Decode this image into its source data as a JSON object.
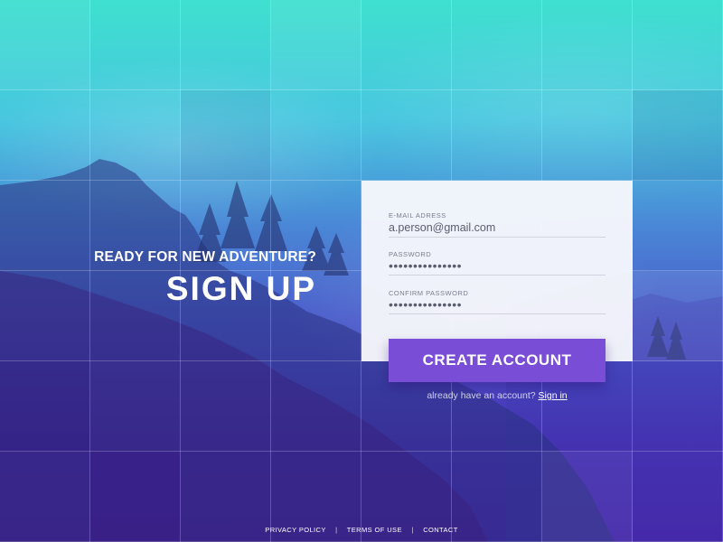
{
  "hero": {
    "tagline": "READY FOR NEW ADVENTURE?",
    "title": "SIGN UP"
  },
  "form": {
    "email_label": "E-MAIL ADRESS",
    "email_value": "a.person@gmail.com",
    "password_label": "PASSWORD",
    "password_value": "•••••••••••••••",
    "confirm_label": "CONFIRM PASSWORD",
    "confirm_value": "•••••••••••••••",
    "submit_label": "CREATE ACCOUNT"
  },
  "signin": {
    "prompt": "already have an account?",
    "link": "Sign in"
  },
  "footer": {
    "links": [
      "PRIVACY POLICY",
      "TERMS OF USE",
      "CONTACT"
    ],
    "separator": "|"
  },
  "colors": {
    "accent": "#7a4dd6",
    "gradient_top": "#3fe0cf",
    "gradient_bottom": "#4a22aa"
  }
}
